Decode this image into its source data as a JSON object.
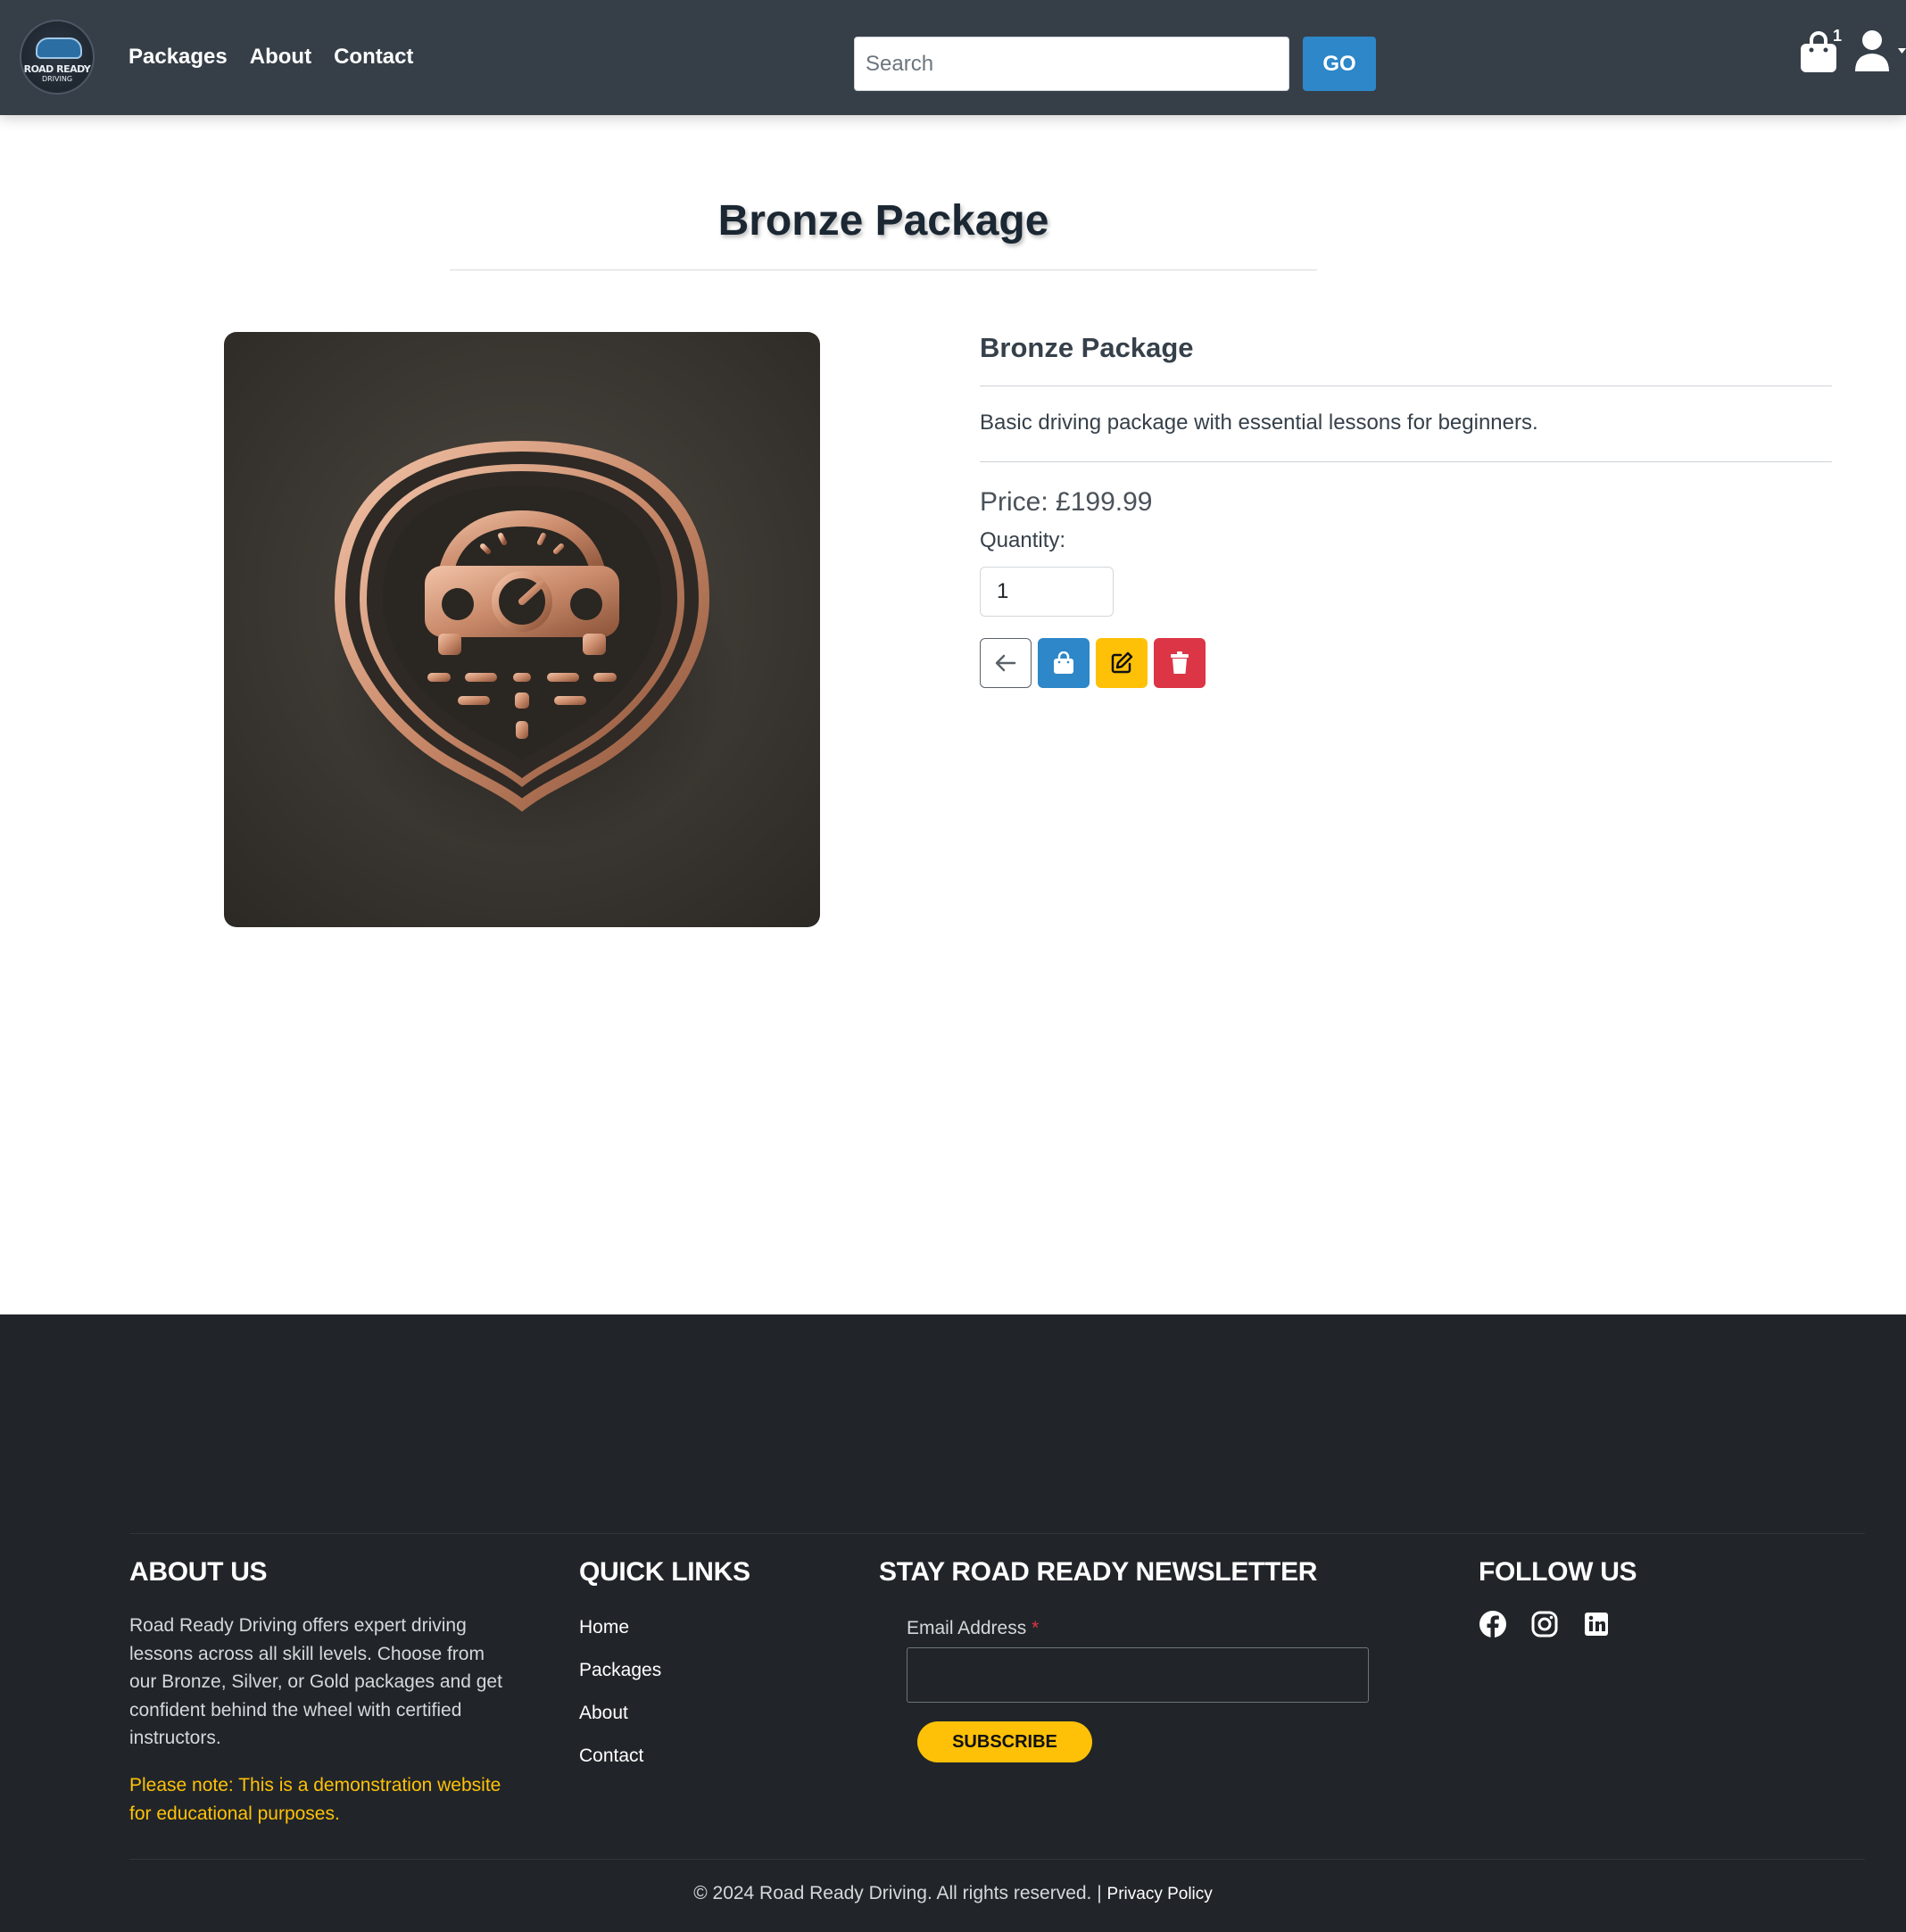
{
  "nav": {
    "logo": {
      "line1": "ROAD READY",
      "line2": "DRIVING"
    },
    "links": [
      "Packages",
      "About",
      "Contact"
    ],
    "search": {
      "placeholder": "Search",
      "value": "",
      "button": "GO"
    },
    "bag_count": "1",
    "icons": [
      "shopping-bag-icon",
      "user-icon",
      "caret-down-icon"
    ]
  },
  "page": {
    "title": "Bronze Package"
  },
  "product": {
    "name": "Bronze Package",
    "description": "Basic driving package with essential lessons for beginners.",
    "price_label": "Price: £199.99",
    "quantity_label": "Quantity:",
    "quantity_value": "1",
    "image_icon": "bronze-car-speedometer-badge",
    "actions": [
      "arrow-left-icon",
      "shopping-bag-icon",
      "edit-icon",
      "trash-icon"
    ],
    "colors": {
      "primary": "#2d87c8",
      "warning": "#ffc107",
      "danger": "#dc3545"
    }
  },
  "footer": {
    "about": {
      "heading": "ABOUT US",
      "text": "Road Ready Driving offers expert driving lessons across all skill levels. Choose from our Bronze, Silver, or Gold packages and get confident behind the wheel with certified instructors.",
      "note": "Please note: This is a demonstration website for educational purposes."
    },
    "quick_links": {
      "heading": "QUICK LINKS",
      "items": [
        "Home",
        "Packages",
        "About",
        "Contact"
      ]
    },
    "newsletter": {
      "heading": "STAY ROAD READY NEWSLETTER",
      "email_label": "Email Address",
      "required_mark": "*",
      "email_value": "",
      "button": "SUBSCRIBE"
    },
    "follow": {
      "heading": "FOLLOW US",
      "icons": [
        "facebook-icon",
        "instagram-icon",
        "linkedin-icon"
      ]
    },
    "copyright": "© 2024 Road Ready Driving. All rights reserved. |",
    "privacy": "Privacy Policy"
  }
}
